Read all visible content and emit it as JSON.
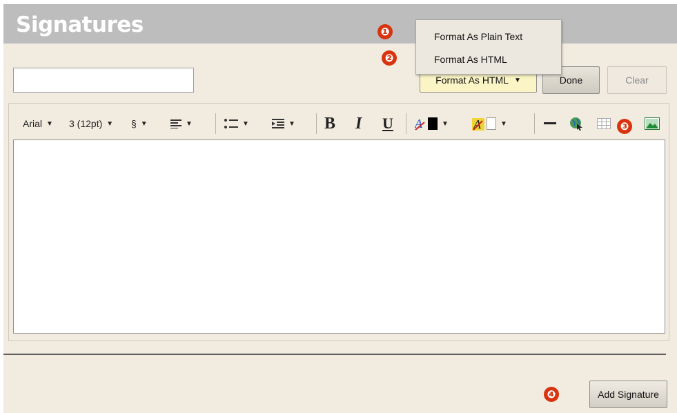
{
  "window": {
    "title": "Signatures"
  },
  "signature_form": {
    "name_input": {
      "value": "",
      "placeholder": ""
    },
    "format_button_label": "Format As HTML",
    "done_label": "Done",
    "clear_label": "Clear",
    "add_signature_label": "Add Signature"
  },
  "format_menu": {
    "items": [
      {
        "label": "Format As Plain Text"
      },
      {
        "label": "Format As HTML"
      }
    ]
  },
  "toolbar": {
    "font_family": "Arial",
    "font_size": "3 (12pt)",
    "style_symbol": "§",
    "bold": "B",
    "italic": "I",
    "underline": "U",
    "icons": [
      "align-left-icon",
      "bullet-list-icon",
      "indent-icon",
      "text-color-icon",
      "highlight-color-icon",
      "horizontal-rule-icon",
      "insert-link-icon",
      "insert-table-icon",
      "insert-image-icon"
    ],
    "text_color": "#000000",
    "highlight_color": "#ffffff"
  },
  "callouts": [
    "❶",
    "❷",
    "❸",
    "❹"
  ],
  "colors": {
    "callout": "#d8340f",
    "title_bar": "#bdbdbd",
    "panel": "#f2ebe0",
    "format_button": "#fbf5c5"
  }
}
